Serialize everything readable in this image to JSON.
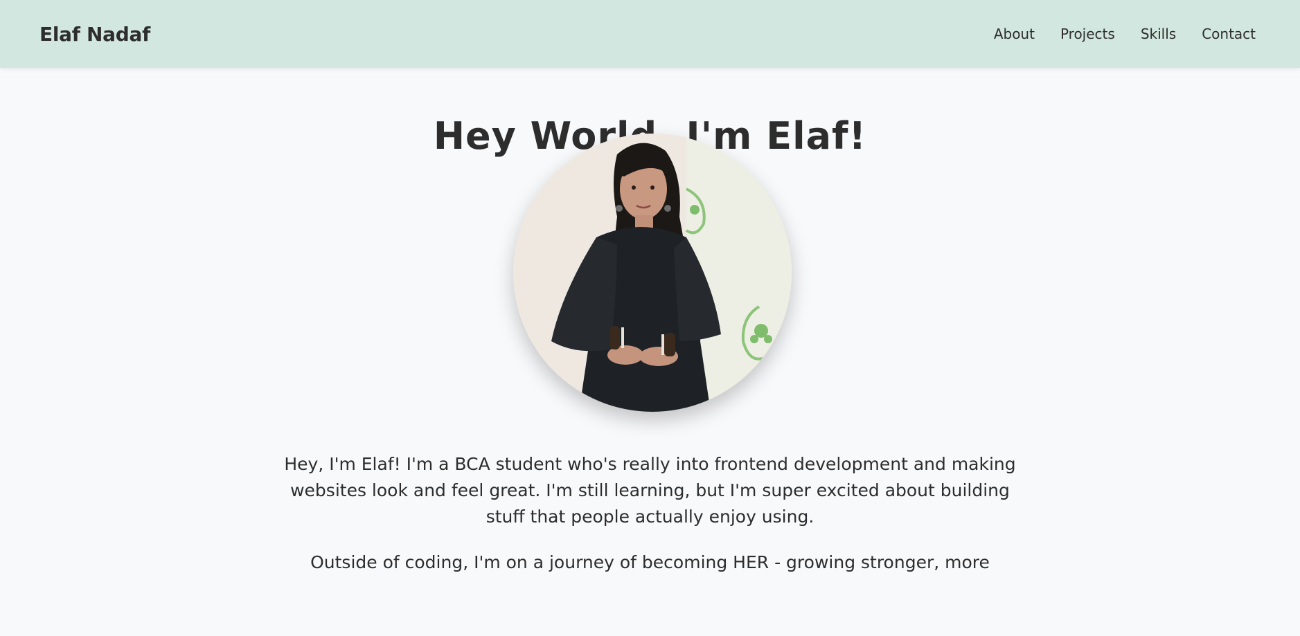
{
  "navbar": {
    "brand": "Elaf Nadaf",
    "links": [
      "About",
      "Projects",
      "Skills",
      "Contact"
    ]
  },
  "hero": {
    "title": "Hey World, I'm Elaf!",
    "photo_icon": "profile-photo"
  },
  "bio": {
    "paragraph_1": "Hey, I'm Elaf! I'm a BCA student who's really into frontend development and making websites look and feel great. I'm still learning, but I'm super excited about building stuff that people actually enjoy using.",
    "paragraph_2": "Outside of coding, I'm on a journey of becoming HER - growing stronger, more"
  },
  "colors": {
    "navbar_bg": "#d2e7df",
    "page_bg": "#f8f9fb",
    "accent_underline": "#c5e0d6",
    "text": "#2d2d2d"
  }
}
